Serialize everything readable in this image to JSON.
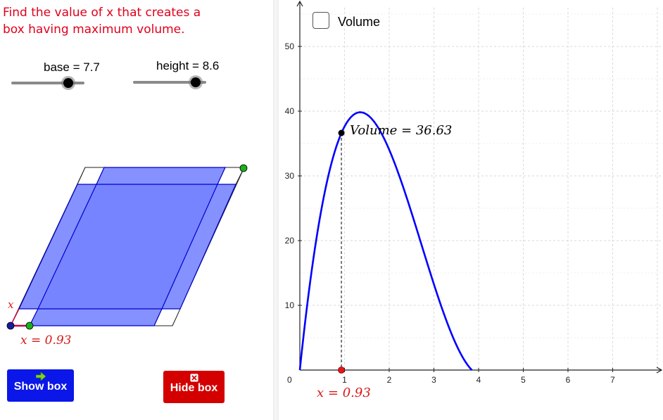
{
  "prompt": {
    "line1": "Find the value of x that creates a",
    "line2": "box having maximum volume."
  },
  "sliders": {
    "base": {
      "label": "base = 7.7",
      "value": 7.7,
      "fraction": 0.78
    },
    "height": {
      "label": "height = 8.6",
      "value": 8.6,
      "fraction": 0.86
    }
  },
  "box_diagram": {
    "x_label": "x",
    "x_value_label": "x = 0.93",
    "colors": {
      "fill": "#5c6cff",
      "stroke": "#0000cc",
      "x_segment": "#cc0044"
    }
  },
  "buttons": {
    "show_box": {
      "label": "Show box",
      "color": "#0a17e8",
      "icon": "green-arrow-icon"
    },
    "hide_box": {
      "label": "Hide box",
      "color": "#d40000",
      "icon": "close-icon"
    }
  },
  "graph": {
    "checkbox_label": "Volume",
    "point_label": "Volume = 36.63",
    "x_point_label": "x = 0.93",
    "curve_color": "#0000ff"
  },
  "chart_data": {
    "type": "line",
    "title": "",
    "xlabel": "",
    "ylabel": "",
    "xlim": [
      -0.2,
      8
    ],
    "ylim": [
      -1,
      56
    ],
    "origin_label": "0",
    "x_ticks": [
      "1",
      "2",
      "3",
      "4",
      "5",
      "6",
      "7"
    ],
    "y_ticks": [
      "10",
      "20",
      "30",
      "40",
      "50"
    ],
    "grid": true,
    "function": "V(x) = x(7.7 - 2x)(8.6 - 2x)",
    "domain": [
      0,
      3.85
    ],
    "series": [
      {
        "x": [
          0,
          0.25,
          0.5,
          0.75,
          0.93,
          1.0,
          1.25,
          1.38,
          1.5,
          1.75,
          2.0,
          2.25,
          2.5,
          2.75,
          3.0,
          3.25,
          3.5,
          3.75,
          3.85
        ],
        "y": [
          0,
          15.96,
          27.12,
          34.05,
          36.63,
          37.45,
          38.99,
          39.09,
          38.85,
          37.06,
          33.6,
          29.7,
          24.9,
          19.8,
          14.4,
          9.5,
          5.2,
          1.6,
          0
        ]
      }
    ],
    "highlight_point": {
      "x": 0.93,
      "y": 36.63
    }
  }
}
